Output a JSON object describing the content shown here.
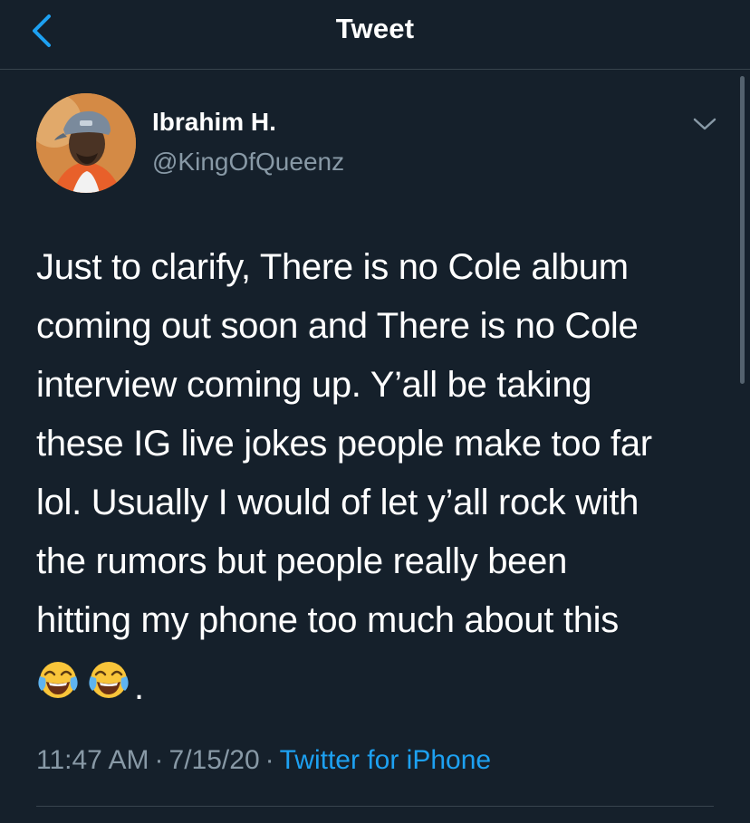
{
  "header": {
    "title": "Tweet",
    "back_icon": "chevron-left-icon"
  },
  "tweet": {
    "author": {
      "display_name": "Ibrahim H.",
      "handle": "@KingOfQueenz"
    },
    "more_icon": "chevron-down-icon",
    "text_lines": [
      "Just to clarify, There is no Cole album",
      "coming out soon and There is no Cole",
      "interview coming up. Y’all be taking",
      "these IG live jokes people make too far",
      "lol. Usually I would of let y’all rock with",
      "the rumors but people really been",
      "hitting my phone too much about this"
    ],
    "emojis": [
      "face-with-tears-of-joy-icon",
      "face-with-tears-of-joy-icon"
    ],
    "trailing_text": ".",
    "meta": {
      "time": "11:47 AM",
      "separator": "·",
      "date": "7/15/20",
      "source": "Twitter for iPhone"
    }
  },
  "colors": {
    "background": "#15202b",
    "divider": "#38444d",
    "secondary_text": "#8899a6",
    "accent": "#1da1f2",
    "primary_text": "#ffffff"
  }
}
